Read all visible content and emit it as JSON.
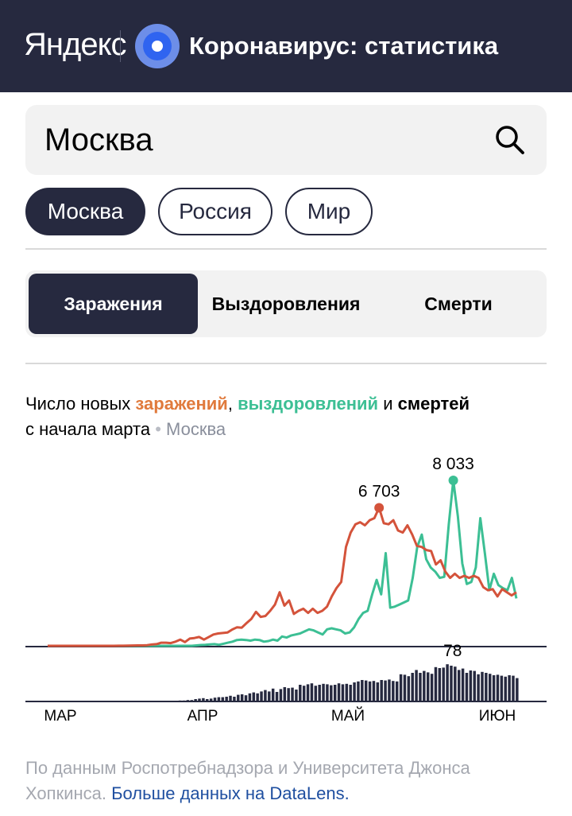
{
  "header": {
    "brand": "Яндекс",
    "title": "Коронавирус: статистика",
    "logo_icon": "target-logo-icon",
    "bg_color": "#26293f"
  },
  "search": {
    "value": "Москва",
    "icon": "search-icon"
  },
  "regions": [
    {
      "label": "Москва",
      "active": true
    },
    {
      "label": "Россия",
      "active": false
    },
    {
      "label": "Мир",
      "active": false
    }
  ],
  "tabs": [
    {
      "label": "Заражения",
      "active": true
    },
    {
      "label": "Выздоровления",
      "active": false
    },
    {
      "label": "Смерти",
      "active": false
    }
  ],
  "caption": {
    "prefix": "Число новых ",
    "infections": "заражений",
    "comma": ", ",
    "recoveries": "выздоровлений",
    "and": " и ",
    "deaths": "смертей",
    "line2": "с начала марта",
    "dot": "•",
    "location": "Москва"
  },
  "colors": {
    "infections": "#d4533b",
    "recoveries": "#3cbf94",
    "deaths": "#26293f"
  },
  "chart_data": {
    "type": "line",
    "x_start": "2020-03-01",
    "x_end": "2020-06-08",
    "x_ticks": [
      "МАР",
      "АПР",
      "МАЙ",
      "ИЮН"
    ],
    "series": [
      {
        "name": "заражений",
        "color": "#d4533b",
        "values": [
          0,
          0,
          0,
          0,
          0,
          0,
          0,
          0,
          0,
          0,
          0,
          0,
          0,
          0,
          0,
          2,
          5,
          10,
          15,
          20,
          20,
          30,
          60,
          80,
          150,
          150,
          130,
          200,
          300,
          180,
          350,
          380,
          430,
          300,
          420,
          550,
          600,
          620,
          650,
          790,
          900,
          880,
          1100,
          1300,
          1650,
          1400,
          1450,
          1700,
          2000,
          2600,
          1950,
          2200,
          1550,
          1700,
          1800,
          1600,
          1800,
          1600,
          1700,
          1900,
          2400,
          2800,
          3100,
          4800,
          5500,
          5900,
          6000,
          5850,
          6100,
          6200,
          6703,
          5950,
          5900,
          6100,
          5600,
          5500,
          5850,
          5400,
          4850,
          4800,
          4650,
          4600,
          3950,
          4150,
          3600,
          3300,
          3500,
          3300,
          3400,
          3300,
          3400,
          3300,
          2850,
          2700,
          2750,
          2400,
          2750,
          2600,
          2450,
          2600
        ]
      },
      {
        "name": "выздоровлений",
        "color": "#3cbf94",
        "values": [
          0,
          0,
          0,
          0,
          0,
          0,
          0,
          0,
          0,
          0,
          0,
          0,
          0,
          0,
          0,
          0,
          0,
          0,
          0,
          0,
          0,
          0,
          0,
          0,
          0,
          0,
          0,
          0,
          0,
          0,
          0,
          0,
          0,
          20,
          40,
          50,
          70,
          80,
          50,
          100,
          150,
          200,
          280,
          300,
          280,
          250,
          300,
          280,
          200,
          230,
          300,
          250,
          450,
          400,
          500,
          550,
          600,
          700,
          800,
          750,
          650,
          550,
          800,
          850,
          800,
          750,
          600,
          650,
          900,
          1300,
          1600,
          1700,
          2500,
          3200,
          2500,
          4500,
          1850,
          1900,
          2000,
          2100,
          2200,
          3300,
          4800,
          5400,
          4200,
          3800,
          3600,
          3300,
          3350,
          5900,
          8033,
          6300,
          4000,
          3000,
          3100,
          3800,
          6200,
          4500,
          2700,
          3500,
          2950,
          2800,
          2700,
          3300,
          2300
        ]
      },
      {
        "name": "смертей",
        "color": "#26293f",
        "values": [
          0,
          0,
          0,
          0,
          0,
          0,
          0,
          0,
          0,
          0,
          0,
          0,
          0,
          0,
          0,
          0,
          0,
          0,
          0,
          0,
          0,
          0,
          0,
          0,
          0,
          0,
          0,
          0,
          0,
          0,
          0,
          0,
          1,
          2,
          2,
          3,
          3,
          5,
          6,
          7,
          5,
          6,
          8,
          9,
          9,
          10,
          12,
          10,
          14,
          15,
          13,
          17,
          19,
          17,
          21,
          24,
          21,
          27,
          20,
          26,
          30,
          28,
          29,
          25,
          35,
          33,
          36,
          38,
          33,
          35,
          37,
          36,
          34,
          35,
          38,
          36,
          37,
          35,
          40,
          42,
          45,
          44,
          42,
          43,
          40,
          45,
          44,
          46,
          43,
          42,
          57,
          56,
          53,
          60,
          66,
          60,
          64,
          61,
          58,
          72,
          70,
          71,
          78,
          75,
          73,
          66,
          69,
          60,
          65,
          64,
          57,
          62,
          60,
          58,
          55,
          56,
          54,
          52,
          55,
          54,
          49
        ]
      }
    ],
    "annotations": [
      {
        "series": "заражений",
        "value": 6703,
        "label": "6 703"
      },
      {
        "series": "выздоровлений",
        "value": 8033,
        "label": "8 033"
      },
      {
        "series": "смертей",
        "value": 78,
        "label": "78"
      }
    ],
    "legend": "none",
    "grid": false
  },
  "footer": {
    "text": "По данным Роспотребнадзора и Университета Джонса Хопкинса. ",
    "link": "Больше данных на DataLens."
  }
}
